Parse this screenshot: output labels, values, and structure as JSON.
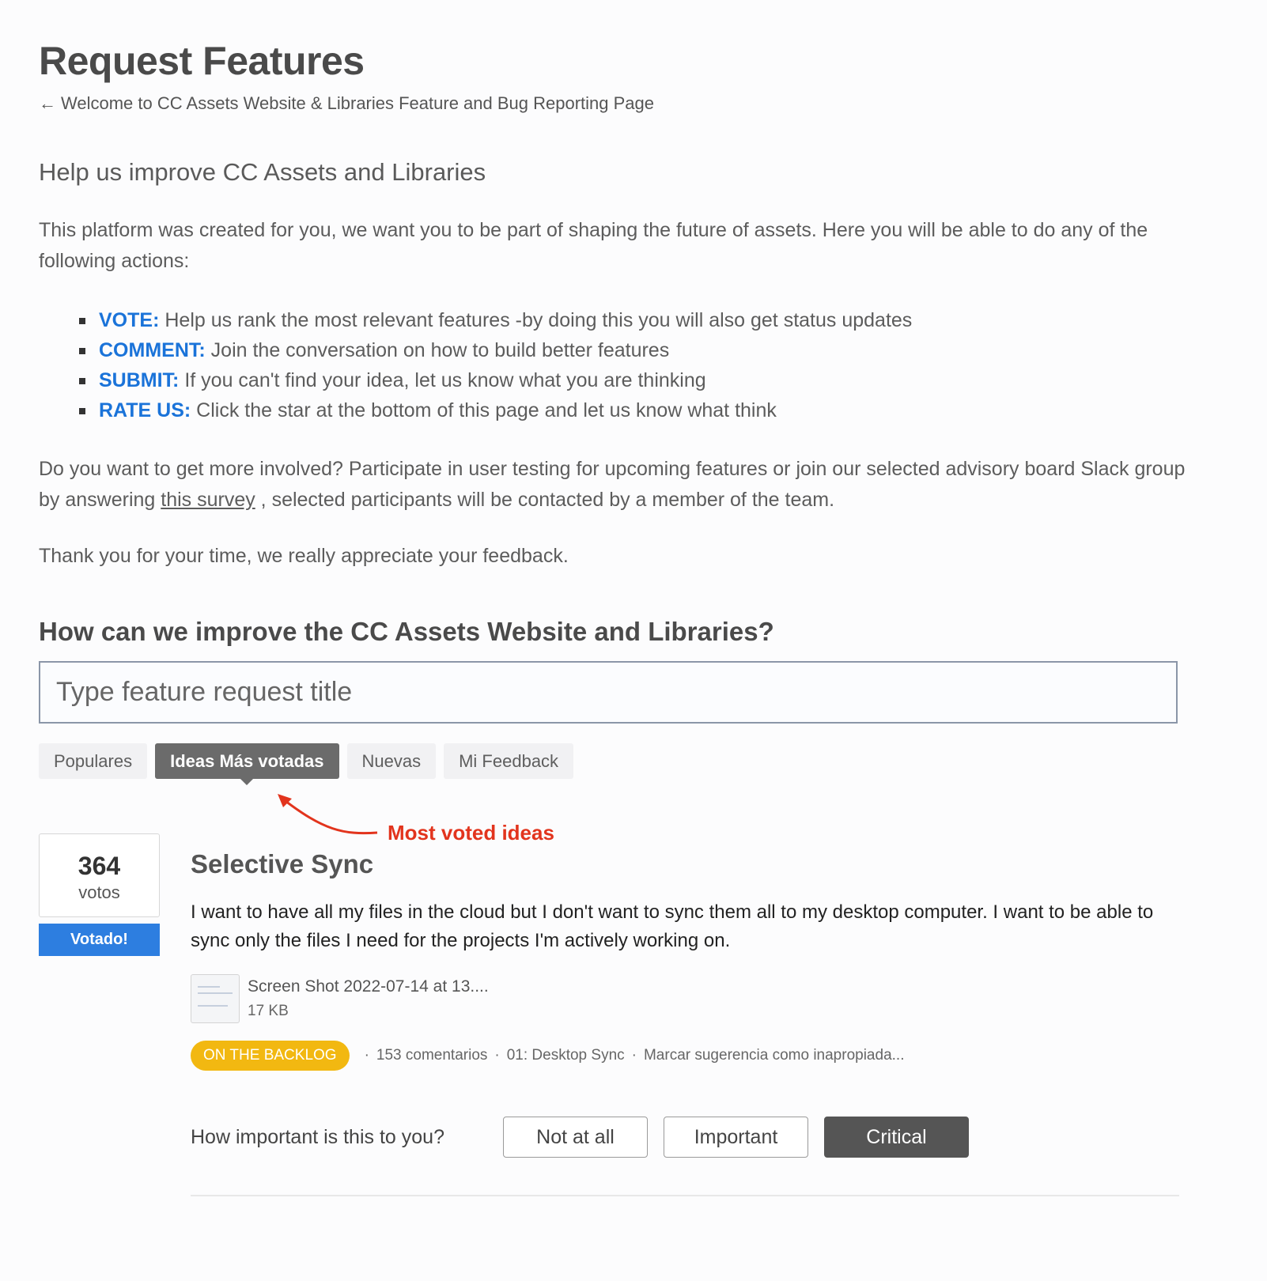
{
  "header": {
    "title": "Request Features",
    "back_link": "Welcome to CC Assets Website & Libraries Feature and Bug Reporting Page"
  },
  "intro": {
    "heading": "Help us improve CC Assets and Libraries",
    "paragraph": "This platform was created for you, we want you to be part of shaping the future of assets. Here you will be able to do any of the following actions:",
    "actions": [
      {
        "keyword": "VOTE:",
        "text": "Help us rank the most relevant features -by doing this you will also get status updates"
      },
      {
        "keyword": "COMMENT:",
        "text": "Join the conversation on how to build better features"
      },
      {
        "keyword": "SUBMIT:",
        "text": "If you can't find your idea, let us know what you are thinking"
      },
      {
        "keyword": "RATE US:",
        "text": "Click the star at the bottom of this page and let us know what think"
      }
    ],
    "involve_before": "Do you want to get more involved? Participate in user testing for upcoming features or join our selected advisory board Slack group by answering ",
    "involve_link": "this survey",
    "involve_after": " , selected participants will be contacted by a member of the team.",
    "thanks": "Thank you for your time, we really appreciate your feedback."
  },
  "feedback": {
    "heading": "How can we improve the CC Assets Website and Libraries?",
    "search_placeholder": "Type feature request title",
    "tabs": [
      "Populares",
      "Ideas Más votadas",
      "Nuevas",
      "Mi Feedback"
    ],
    "active_tab": "Ideas Más votadas",
    "annotation": "Most voted ideas"
  },
  "idea": {
    "votes": "364",
    "votes_label": "votos",
    "voted_label": "Votado!",
    "title": "Selective Sync",
    "description": "I want to have all my files in the cloud but I don't want to sync them all to my desktop computer. I want to be able to sync only the files I need for the projects I'm actively working on.",
    "attachment_name": "Screen Shot 2022-07-14 at 13....",
    "attachment_size": "17 KB",
    "status": "ON THE BACKLOG",
    "comments": "153 comentarios",
    "category": "01: Desktop Sync",
    "flag": "Marcar sugerencia como inapropiada...",
    "importance_question": "How important is this to you?",
    "importance_options": [
      "Not at all",
      "Important",
      "Critical"
    ],
    "importance_selected": "Critical"
  },
  "colors": {
    "accent_blue": "#1a73d9",
    "voted_button": "#2d7ee0",
    "status_badge": "#f2b811",
    "annotation_red": "#e2341d"
  }
}
